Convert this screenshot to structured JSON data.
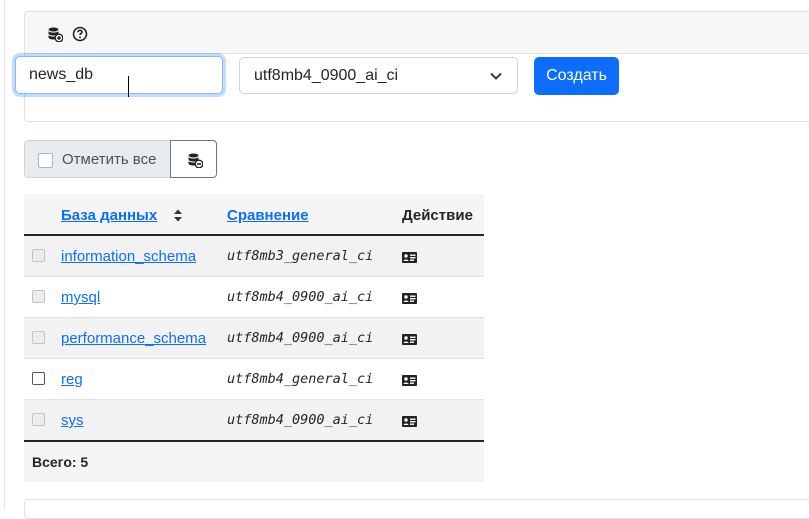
{
  "create_form": {
    "name_value": "news_db",
    "collation_selected": "utf8mb4_0900_ai_ci",
    "create_label": "Создать",
    "header_icons": [
      "database-add-icon",
      "help-icon"
    ]
  },
  "bulk": {
    "select_all_label": "Отметить все",
    "drop_icon": "database-drop-icon"
  },
  "table": {
    "headers": {
      "database": "База данных",
      "collation": "Сравнение",
      "action": "Действие"
    },
    "rows": [
      {
        "name": "information_schema",
        "collation": "utf8mb3_general_ci",
        "system": true
      },
      {
        "name": "mysql",
        "collation": "utf8mb4_0900_ai_ci",
        "system": true
      },
      {
        "name": "performance_schema",
        "collation": "utf8mb4_0900_ai_ci",
        "system": true
      },
      {
        "name": "reg",
        "collation": "utf8mb4_general_ci",
        "system": false
      },
      {
        "name": "sys",
        "collation": "utf8mb4_0900_ai_ci",
        "system": true
      }
    ],
    "total_label": "Всего: 5"
  },
  "colors": {
    "accent": "#0d6efd",
    "link": "#0d6efd"
  }
}
